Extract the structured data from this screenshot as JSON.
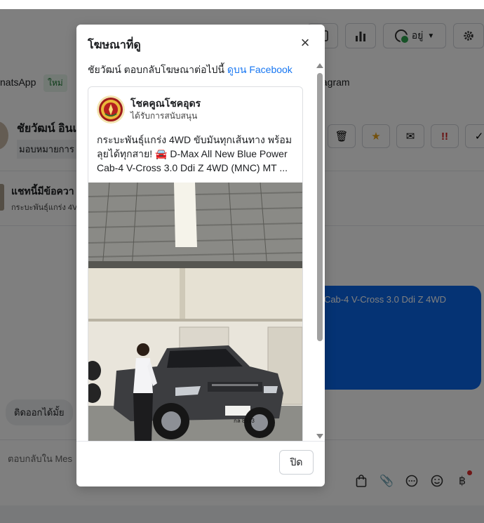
{
  "background": {
    "status_label": "อยู่",
    "channels": {
      "whatsapp": "natsApp",
      "new_badge": "ใหม่",
      "instagram": "tagram"
    },
    "contact": {
      "name": "ชัยวัฒน์ อินเ",
      "assign": "มอบหมายการ"
    },
    "ad_thread": {
      "title": "แชทนี้มีข้อควา",
      "subtitle": "กระบะพันธุ์แกร่ง 4V"
    },
    "outgoing_bubble": "r Cab-4 V-Cross 3.0 Ddi Z 4WD",
    "incoming_bubble": "ติดออกได้มั้ย",
    "composer_placeholder": "ตอบกลับใน Mes"
  },
  "modal": {
    "title": "โฆษณาที่ดู",
    "description_prefix": "ชัยวัฒน์ ตอบกลับโฆษณาต่อไปนี้",
    "description_link": "ดูบน Facebook",
    "ad": {
      "page_name": "โชคคูณโชคอุดร",
      "sponsored": "ได้รับการสนับสนุน",
      "text": "กระบะพันธุ์แกร่ง 4WD ขับมันทุกเส้นทาง พร้อมลุยได้ทุกสาย! 🚘 D-Max All New Blue Power Cab-4 V-Cross 3.0 Ddi Z 4WD (MNC) MT ...",
      "plate": "กล 8513"
    },
    "footer_close": "ปิด"
  }
}
